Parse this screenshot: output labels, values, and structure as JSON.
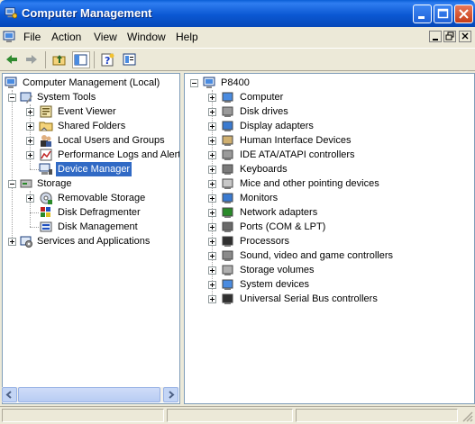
{
  "window": {
    "title": "Computer Management",
    "title_icon": "computer-management-icon",
    "controls": [
      "minimize",
      "maximize",
      "close"
    ]
  },
  "menubar": {
    "items": [
      "File",
      "Action",
      "View",
      "Window",
      "Help"
    ]
  },
  "toolbar": {
    "buttons": [
      "back-icon",
      "forward-icon",
      "up-folder-icon",
      "show-hide-tree-icon",
      "help-icon",
      "properties-icon"
    ]
  },
  "left_tree": {
    "root": "Computer Management (Local)",
    "system_tools": "System Tools",
    "event_viewer": "Event Viewer",
    "shared_folders": "Shared Folders",
    "local_users": "Local Users and Groups",
    "perf_logs": "Performance Logs and Alerts",
    "device_manager": "Device Manager",
    "storage": "Storage",
    "removable_storage": "Removable Storage",
    "disk_defrag": "Disk Defragmenter",
    "disk_management": "Disk Management",
    "services_apps": "Services and Applications",
    "selected": "Device Manager"
  },
  "right_tree": {
    "root": "P8400",
    "items": [
      "Computer",
      "Disk drives",
      "Display adapters",
      "Human Interface Devices",
      "IDE ATA/ATAPI controllers",
      "Keyboards",
      "Mice and other pointing devices",
      "Monitors",
      "Network adapters",
      "Ports (COM & LPT)",
      "Processors",
      "Sound, video and game controllers",
      "Storage volumes",
      "System devices",
      "Universal Serial Bus controllers"
    ]
  },
  "colors": {
    "title_bar": "#0b58d3",
    "selection": "#316ac5",
    "window_bg": "#ece9d8"
  }
}
